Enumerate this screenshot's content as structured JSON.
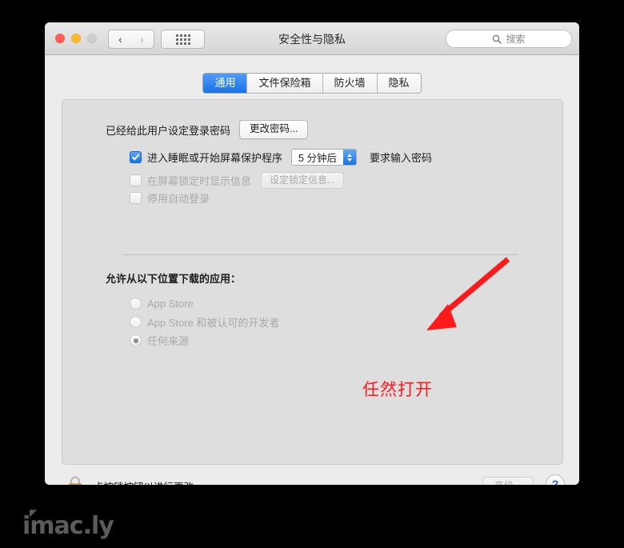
{
  "window": {
    "title": "安全性与隐私",
    "traffic_lights": {
      "close": "close-button",
      "minimize": "minimize-button",
      "zoom": "zoom-button"
    },
    "nav": {
      "back_glyph": "‹",
      "forward_glyph": "›",
      "grid_icon": "grid-icon"
    },
    "search": {
      "placeholder": "搜索",
      "icon": "search-icon"
    }
  },
  "tabs": [
    {
      "label": "通用",
      "active": true
    },
    {
      "label": "文件保险箱",
      "active": false
    },
    {
      "label": "防火墙",
      "active": false
    },
    {
      "label": "隐私",
      "active": false
    }
  ],
  "general": {
    "password_label": "已经给此用户设定登录密码",
    "change_password_button": "更改密码...",
    "sleep_checkbox": {
      "label": "进入睡眠或开始屏幕保护程序",
      "checked": true,
      "delay_value": "5 分钟后",
      "trailing_label": "要求输入密码"
    },
    "lock_message_checkbox": {
      "label": "在屏幕锁定时显示信息",
      "checked": false,
      "button": "设定锁定信息..."
    },
    "disable_auto_login_checkbox": {
      "label": "停用自动登录",
      "checked": false
    },
    "download_heading": "允许从以下位置下载的应用：",
    "download_options": [
      {
        "label": "App Store",
        "selected": false
      },
      {
        "label": "App Store 和被认可的开发者",
        "selected": false
      },
      {
        "label": "任何来源",
        "selected": true
      }
    ]
  },
  "annotation": {
    "text": "任然打开",
    "color": "#fc1b1b",
    "arrow": "red-arrow"
  },
  "footer": {
    "lock_icon": "lock-closed-icon",
    "lock_note": "点按锁按钮以进行更改。",
    "advanced_button": "高级...",
    "help_button": "?"
  },
  "watermark": {
    "text": "imac.ly"
  },
  "colors": {
    "accent": "#1673e8",
    "annotation": "#fc1b1b",
    "window_bg": "#ececec",
    "panel_bg": "#dedede",
    "lock_body": "#f0a532"
  }
}
